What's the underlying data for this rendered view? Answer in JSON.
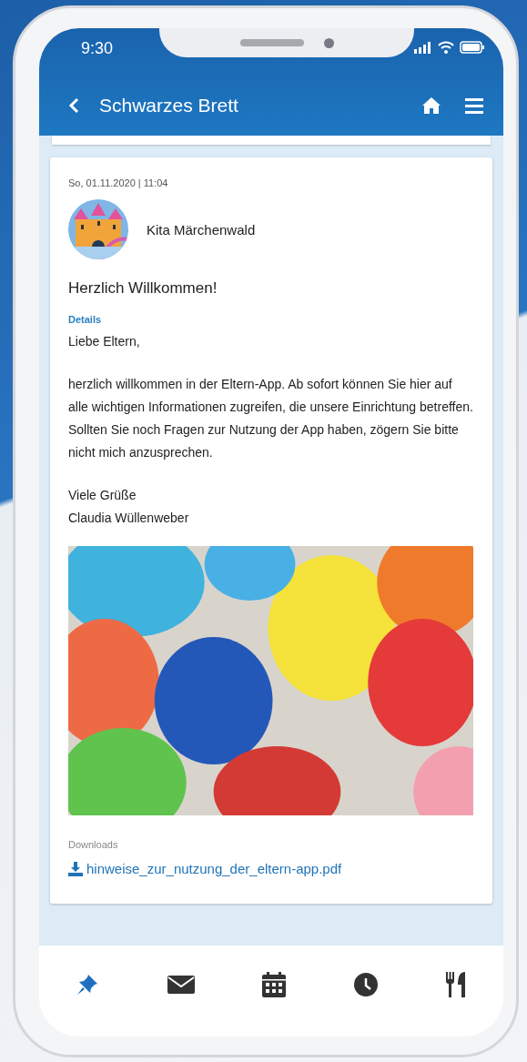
{
  "status_bar": {
    "time": "9:30"
  },
  "header": {
    "title": "Schwarzes Brett"
  },
  "post": {
    "date": "So, 01.11.2020 | 11:04",
    "author": "Kita Märchenwald",
    "title": "Herzlich Willkommen!",
    "section_label": "Details",
    "greeting": "Liebe Eltern,",
    "paragraph": "herzlich willkommen in der Eltern-App. Ab sofort können Sie hier auf alle wichtigen Informationen zugreifen, die unsere Einrichtung betreffen. Sollten Sie noch Fragen zur Nutzung der App haben, zögern Sie bitte nicht mich anzusprechen.",
    "closing": [
      "Viele Grüße",
      "Claudia Wüllenweber"
    ],
    "downloads_label": "Downloads",
    "downloads": [
      "hinweise_zur_nutzung_der_eltern-app.pdf"
    ]
  },
  "bottom_nav": [
    {
      "kind": "pin",
      "selected": true
    },
    {
      "kind": "mail",
      "selected": false
    },
    {
      "kind": "calendar",
      "selected": false
    },
    {
      "kind": "clock",
      "selected": false
    },
    {
      "kind": "food",
      "selected": false
    }
  ]
}
